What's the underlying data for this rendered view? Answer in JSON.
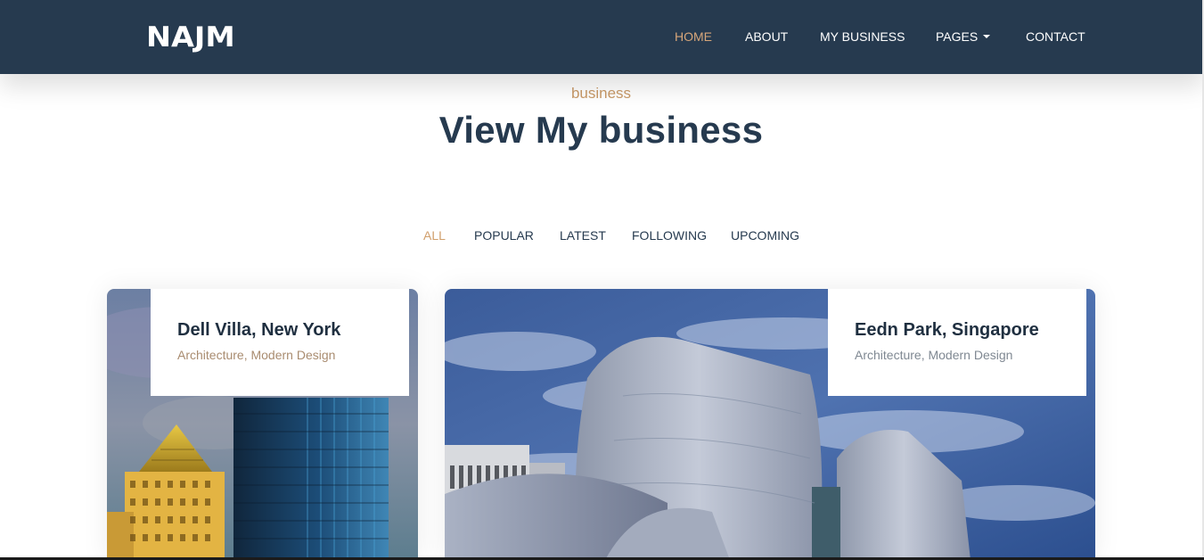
{
  "header": {
    "logo": "NAJM",
    "nav": [
      {
        "label": "HOME",
        "active": true
      },
      {
        "label": "ABOUT",
        "active": false
      },
      {
        "label": "MY BUSINESS",
        "active": false
      },
      {
        "label": "PAGES",
        "active": false,
        "dropdown": true
      },
      {
        "label": "CONTACT",
        "active": false
      }
    ]
  },
  "section": {
    "subtitle": "business",
    "title": "View My business"
  },
  "filters": [
    {
      "label": "ALL",
      "active": true
    },
    {
      "label": "POPULAR",
      "active": false
    },
    {
      "label": "LATEST",
      "active": false
    },
    {
      "label": "FOLLOWING",
      "active": false
    },
    {
      "label": "UPCOMING",
      "active": false
    }
  ],
  "cards": [
    {
      "title": "Dell Villa, New York",
      "subtitle": "Architecture, Modern Design"
    },
    {
      "title": "Eedn Park, Singapore",
      "subtitle": "Architecture, Modern Design"
    }
  ],
  "colors": {
    "header_bg": "#263a4f",
    "accent": "#d7a67a",
    "heading": "#263a4f"
  }
}
